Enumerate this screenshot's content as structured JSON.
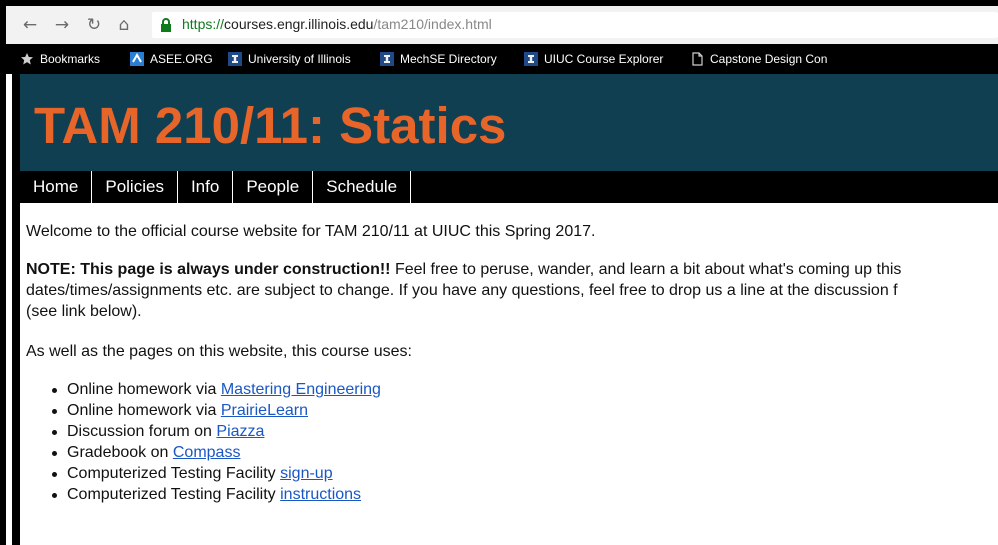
{
  "browser": {
    "url_scheme": "https://",
    "url_host": "courses.engr.illinois.edu",
    "url_path": "/tam210/index.html",
    "bookmarks": [
      {
        "label": "Bookmarks",
        "icon": "star-icon"
      },
      {
        "label": "ASEE.ORG",
        "icon": "asee-icon"
      },
      {
        "label": "University of Illinois",
        "icon": "illinois-i-icon"
      },
      {
        "label": "MechSE Directory",
        "icon": "illinois-i-icon"
      },
      {
        "label": "UIUC Course Explorer",
        "icon": "illinois-i-icon"
      },
      {
        "label": "Capstone Design Con",
        "icon": "page-icon"
      }
    ]
  },
  "site": {
    "title": "TAM 210/11: Statics",
    "nav": [
      "Home",
      "Policies",
      "Info",
      "People",
      "Schedule"
    ]
  },
  "content": {
    "welcome": "Welcome to the official course website for TAM 210/11 at UIUC this Spring 2017.",
    "note_bold": "NOTE: This page is always under construction!!",
    "note_rest_line1": " Feel free to peruse, wander, and learn a bit about what's coming up this",
    "note_line2": "dates/times/assignments etc. are subject to change. If you have any questions, feel free to drop us a line at the discussion f",
    "note_line3": "(see link below).",
    "uses_intro": "As well as the pages on this website, this course uses:",
    "items": [
      {
        "text": "Online homework via ",
        "link": "Mastering Engineering"
      },
      {
        "text": "Online homework via ",
        "link": "PrairieLearn"
      },
      {
        "text": "Discussion forum on ",
        "link": "Piazza"
      },
      {
        "text": "Gradebook on ",
        "link": "Compass"
      },
      {
        "text": "Computerized Testing Facility ",
        "link": "sign-up"
      },
      {
        "text": "Computerized Testing Facility ",
        "link": "instructions"
      }
    ]
  },
  "colors": {
    "banner_bg": "#113f52",
    "title_orange": "#e8652a",
    "link_blue": "#1a57c4",
    "https_green": "#0e7a1e"
  }
}
